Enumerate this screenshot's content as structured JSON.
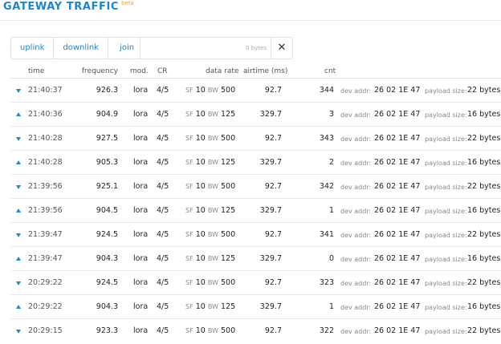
{
  "header": {
    "title": "GATEWAY TRAFFIC",
    "badge": "beta"
  },
  "filters": {
    "uplink": "uplink",
    "downlink": "downlink",
    "join": "join"
  },
  "search": {
    "value": "0 bytes",
    "clear_glyph": "✕"
  },
  "columns": {
    "time": "time",
    "frequency": "frequency",
    "mod": "mod.",
    "cr": "CR",
    "data_rate": "data rate",
    "airtime": "airtime (ms)",
    "cnt": "cnt"
  },
  "labels": {
    "dev_addr": "dev addr:",
    "payload_size": "payload size:"
  },
  "rows": [
    {
      "dir": "down",
      "time": "21:40:37",
      "freq": "926.3",
      "mod": "lora",
      "cr": "4/5",
      "sf": "SF",
      "sfv": "10",
      "bw": "BW",
      "bwv": "500",
      "airtime": "92.7",
      "cnt": "344",
      "dev": "26 02 1E 47",
      "payload": "22 bytes"
    },
    {
      "dir": "up",
      "time": "21:40:36",
      "freq": "904.9",
      "mod": "lora",
      "cr": "4/5",
      "sf": "SF",
      "sfv": "10",
      "bw": "BW",
      "bwv": "125",
      "airtime": "329.7",
      "cnt": "3",
      "dev": "26 02 1E 47",
      "payload": "16 bytes"
    },
    {
      "dir": "down",
      "time": "21:40:28",
      "freq": "927.5",
      "mod": "lora",
      "cr": "4/5",
      "sf": "SF",
      "sfv": "10",
      "bw": "BW",
      "bwv": "500",
      "airtime": "92.7",
      "cnt": "343",
      "dev": "26 02 1E 47",
      "payload": "22 bytes"
    },
    {
      "dir": "up",
      "time": "21:40:28",
      "freq": "905.3",
      "mod": "lora",
      "cr": "4/5",
      "sf": "SF",
      "sfv": "10",
      "bw": "BW",
      "bwv": "125",
      "airtime": "329.7",
      "cnt": "2",
      "dev": "26 02 1E 47",
      "payload": "16 bytes"
    },
    {
      "dir": "down",
      "time": "21:39:56",
      "freq": "925.1",
      "mod": "lora",
      "cr": "4/5",
      "sf": "SF",
      "sfv": "10",
      "bw": "BW",
      "bwv": "500",
      "airtime": "92.7",
      "cnt": "342",
      "dev": "26 02 1E 47",
      "payload": "22 bytes"
    },
    {
      "dir": "up",
      "time": "21:39:56",
      "freq": "904.5",
      "mod": "lora",
      "cr": "4/5",
      "sf": "SF",
      "sfv": "10",
      "bw": "BW",
      "bwv": "125",
      "airtime": "329.7",
      "cnt": "1",
      "dev": "26 02 1E 47",
      "payload": "16 bytes"
    },
    {
      "dir": "down",
      "time": "21:39:47",
      "freq": "924.5",
      "mod": "lora",
      "cr": "4/5",
      "sf": "SF",
      "sfv": "10",
      "bw": "BW",
      "bwv": "500",
      "airtime": "92.7",
      "cnt": "341",
      "dev": "26 02 1E 47",
      "payload": "22 bytes"
    },
    {
      "dir": "up",
      "time": "21:39:47",
      "freq": "904.3",
      "mod": "lora",
      "cr": "4/5",
      "sf": "SF",
      "sfv": "10",
      "bw": "BW",
      "bwv": "125",
      "airtime": "329.7",
      "cnt": "0",
      "dev": "26 02 1E 47",
      "payload": "16 bytes"
    },
    {
      "dir": "down",
      "time": "20:29:22",
      "freq": "924.5",
      "mod": "lora",
      "cr": "4/5",
      "sf": "SF",
      "sfv": "10",
      "bw": "BW",
      "bwv": "500",
      "airtime": "92.7",
      "cnt": "323",
      "dev": "26 02 1E 47",
      "payload": "22 bytes"
    },
    {
      "dir": "up",
      "time": "20:29:22",
      "freq": "904.3",
      "mod": "lora",
      "cr": "4/5",
      "sf": "SF",
      "sfv": "10",
      "bw": "BW",
      "bwv": "125",
      "airtime": "329.7",
      "cnt": "1",
      "dev": "26 02 1E 47",
      "payload": "16 bytes"
    },
    {
      "dir": "down",
      "time": "20:29:15",
      "freq": "923.3",
      "mod": "lora",
      "cr": "4/5",
      "sf": "SF",
      "sfv": "10",
      "bw": "BW",
      "bwv": "500",
      "airtime": "92.7",
      "cnt": "322",
      "dev": "26 02 1E 47",
      "payload": "22 bytes"
    }
  ],
  "colors": {
    "accent": "#1c86c8",
    "beta": "#f5a623"
  }
}
